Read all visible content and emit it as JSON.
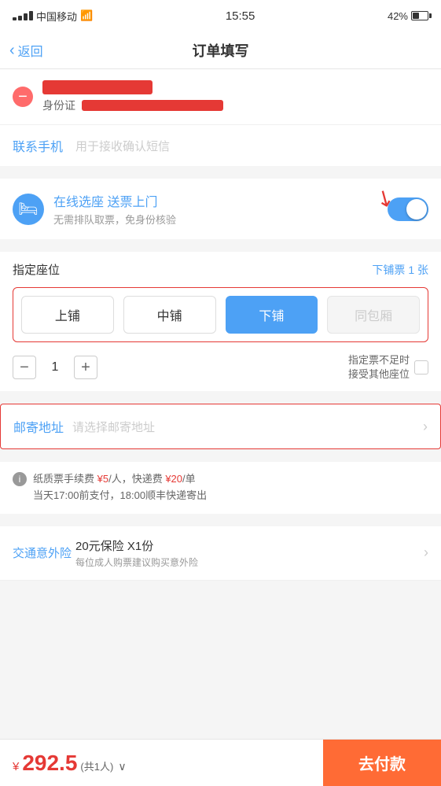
{
  "statusBar": {
    "carrier": "中国移动",
    "wifi": "WiFi",
    "time": "15:55",
    "battery": "42%"
  },
  "navBar": {
    "back": "返回",
    "title": "订单填写"
  },
  "passenger": {
    "idLabel": "身份证"
  },
  "contact": {
    "label": "联系手机",
    "placeholder": "用于接收确认短信"
  },
  "onlineSelect": {
    "title": "在线选座 送票上门",
    "subtitle": "无需排队取票，免身份核验"
  },
  "seatSelection": {
    "label": "指定座位",
    "ticketInfo": "下铺票",
    "ticketCount": "1",
    "ticketUnit": "张",
    "buttons": [
      "上铺",
      "中铺",
      "下铺",
      "同包厢"
    ],
    "activeButton": 2,
    "quantity": "1",
    "otherSeatText": "指定票不足时\n接受其他座位"
  },
  "mailAddress": {
    "label": "邮寄地址",
    "placeholder": "请选择邮寄地址"
  },
  "infoBanner": {
    "text1": "纸质票手续费 ",
    "price1": "¥5",
    "text2": "/人，快递费 ",
    "price2": "¥20",
    "text3": "/单",
    "text4": "当天17:00前支付，18:00顺丰快递寄出"
  },
  "insurance": {
    "label": "交通意外险",
    "title": "20元保险 X1份",
    "subtitle": "每位成人购票建议购买意外险"
  },
  "bottomBar": {
    "priceSymbol": "¥",
    "priceAmount": "292.5",
    "priceSub": "(共1人)",
    "payButton": "去付款"
  }
}
